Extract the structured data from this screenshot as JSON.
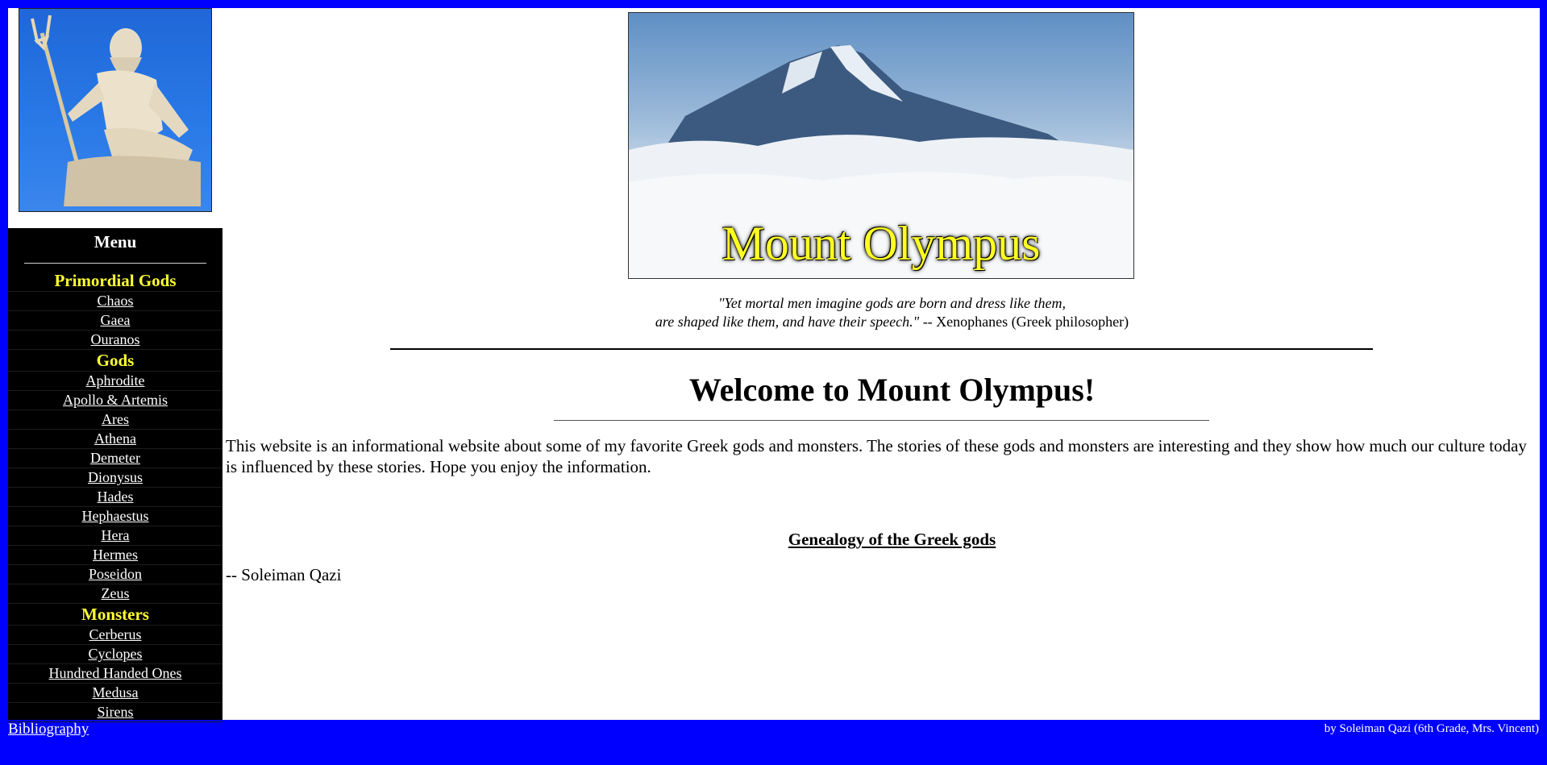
{
  "menu": {
    "title": "Menu",
    "sections": [
      {
        "heading": "Primordial Gods",
        "items": [
          "Chaos",
          "Gaea",
          "Ouranos"
        ]
      },
      {
        "heading": "Gods",
        "items": [
          "Aphrodite",
          "Apollo & Artemis",
          "Ares",
          "Athena",
          "Demeter",
          "Dionysus",
          "Hades",
          "Hephaestus",
          "Hera",
          "Hermes",
          "Poseidon",
          "Zeus"
        ]
      },
      {
        "heading": "Monsters",
        "items": [
          "Cerberus",
          "Cyclopes",
          "Hundred Handed Ones",
          "Medusa",
          "Sirens"
        ]
      }
    ]
  },
  "banner": {
    "title": "Mount Olympus"
  },
  "quote": {
    "line1": "\"Yet mortal men imagine gods are born and dress like them,",
    "line2": "are shaped like them, and have their speech.\"",
    "attribution": " -- Xenophanes (Greek philosopher)"
  },
  "main": {
    "heading": "Welcome to Mount Olympus!",
    "intro": "This website is an informational website about some of my favorite Greek gods and monsters. The stories of these gods and monsters are interesting and they show how much our culture today is influenced by these stories. Hope you enjoy the information.",
    "genealogy_link": "Genealogy of the Greek gods",
    "signature": "-- Soleiman Qazi"
  },
  "footer": {
    "bibliography": "Bibliography",
    "credit": "by Soleiman Qazi (6th Grade, Mrs. Vincent)"
  },
  "colors": {
    "page_border": "#0000ff",
    "menu_bg": "#000000",
    "menu_heading": "#ffff33"
  }
}
